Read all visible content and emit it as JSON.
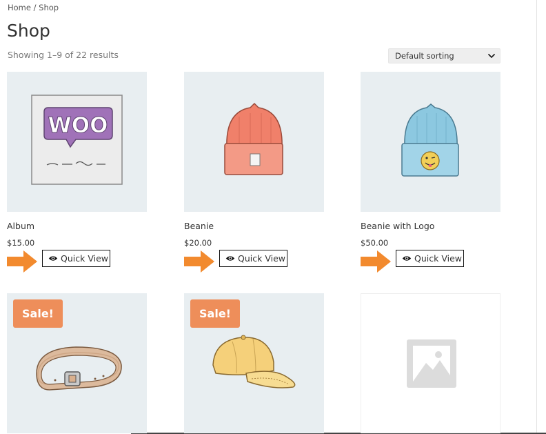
{
  "breadcrumb": {
    "home": "Home",
    "separator": "/",
    "current": "Shop"
  },
  "page_title": "Shop",
  "result_count": "Showing 1–9 of 22 results",
  "sorting": {
    "selected": "Default sorting"
  },
  "quick_view_label": "Quick View",
  "sale_label": "Sale!",
  "colors": {
    "arrow": "#f28a2e",
    "sale_badge": "#ee8e5a",
    "thumb_bg": "#e8eef1"
  },
  "products": [
    {
      "name": "Album",
      "price": "$15.00",
      "image": "album-image"
    },
    {
      "name": "Beanie",
      "price": "$20.00",
      "image": "beanie-image"
    },
    {
      "name": "Beanie with Logo",
      "price": "$50.00",
      "image": "beanie-with-logo-image"
    },
    {
      "image": "belt-image",
      "on_sale": true
    },
    {
      "image": "cap-image",
      "on_sale": true
    },
    {
      "image": "placeholder-image"
    }
  ]
}
